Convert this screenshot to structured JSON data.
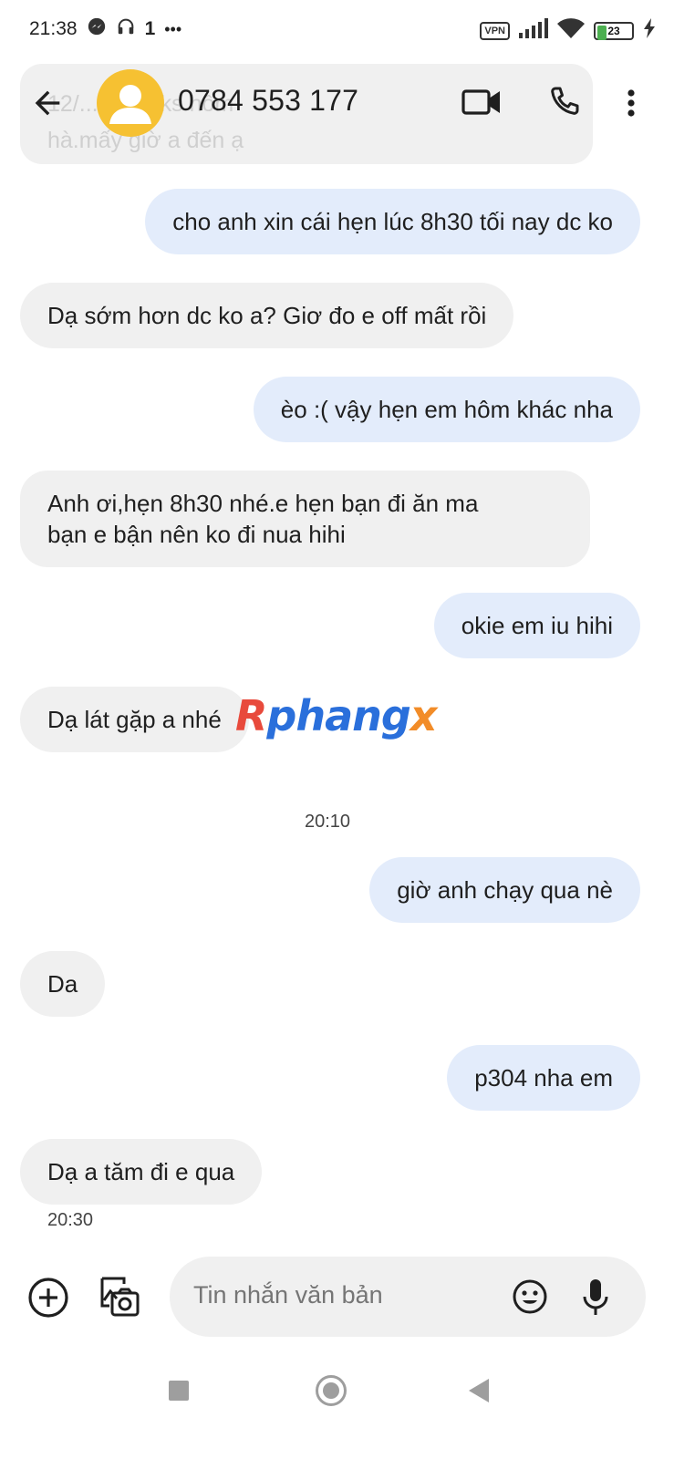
{
  "status_bar": {
    "time": "21:38",
    "sim_indicator": "1",
    "more_indicator": "•••",
    "vpn_label": "VPN",
    "battery_level": "23",
    "icons": [
      "messenger-icon",
      "headset-icon",
      "signal-icon",
      "wifi-icon",
      "battery-icon",
      "charging-icon"
    ]
  },
  "header": {
    "contact_name": "0784 553 177",
    "partial_message_line1": "12/... ...oin.ks hôm",
    "partial_message_line2": "hà.mấy giờ a đến ạ",
    "icons": [
      "back-arrow-icon",
      "person-avatar-icon",
      "video-call-icon",
      "phone-icon",
      "more-vert-icon"
    ]
  },
  "messages": [
    {
      "type": "sent",
      "text": "cho anh xin cái hẹn lúc 8h30 tối nay dc ko"
    },
    {
      "type": "received",
      "text": "Dạ sớm hơn dc ko a? Giơ đo e off mất rồi"
    },
    {
      "type": "sent",
      "text": "èo :( vậy hẹn em hôm khác nha"
    },
    {
      "type": "received",
      "text_line1": "Anh ơi,hẹn 8h30 nhé.e hẹn bạn đi ăn ma",
      "text_line2": "bạn e bận nên ko đi nua hihi"
    },
    {
      "type": "sent",
      "text": "okie em iu hihi"
    },
    {
      "type": "received",
      "text": "Dạ lát gặp a nhé"
    },
    {
      "type": "timestamp",
      "text": "20:10"
    },
    {
      "type": "sent",
      "text": "giờ anh chạy qua nè"
    },
    {
      "type": "received",
      "text": "Da"
    },
    {
      "type": "sent",
      "text": "p304 nha em"
    },
    {
      "type": "received",
      "text": "Dạ a tăm đi e qua"
    },
    {
      "type": "timestamp",
      "text": "20:30"
    }
  ],
  "watermark": {
    "part1": "R",
    "part2": "phang",
    "part3": "x"
  },
  "composer": {
    "placeholder": "Tin nhắn văn bản",
    "icons": [
      "add-circle-icon",
      "gallery-camera-icon",
      "emoji-icon",
      "mic-icon"
    ]
  },
  "nav_bar": {
    "icons": [
      "recent-apps-icon",
      "home-icon",
      "nav-back-icon"
    ]
  },
  "colors": {
    "sent_bubble": "#e3ecfb",
    "received_bubble": "#f0f0f0",
    "avatar": "#f6c132",
    "battery": "#4caf50"
  }
}
